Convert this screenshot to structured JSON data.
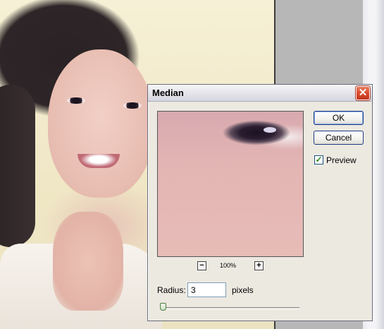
{
  "dialog": {
    "title": "Median",
    "close_glyph": "✕",
    "ok_label": "OK",
    "cancel_label": "Cancel",
    "preview_checkbox": {
      "label": "Preview",
      "checked": true,
      "check_glyph": "✓"
    },
    "zoom": {
      "minus_glyph": "−",
      "plus_glyph": "+",
      "level": "100%"
    },
    "radius": {
      "label": "Radius:",
      "value": "3",
      "unit": "pixels",
      "slider_fraction": 0.0
    }
  }
}
